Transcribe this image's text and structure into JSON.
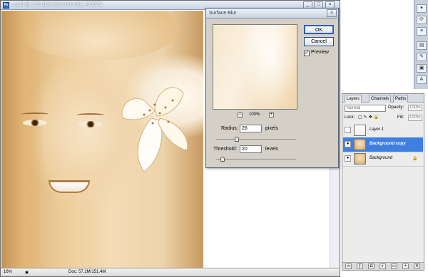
{
  "document": {
    "title": "1.psd @ 16% (Background copy, RGB/8)",
    "ps_icon": "Ps",
    "status_zoom": "16%",
    "status_doc": "Doc: 57.2M/151.4M"
  },
  "dialog": {
    "title": "Surface Blur",
    "ok_label": "OK",
    "cancel_label": "Cancel",
    "preview_label": "Preview",
    "preview_checked": true,
    "zoom_level": "100%",
    "radius_label": "Radius:",
    "radius_value": "26",
    "radius_unit": "pixels",
    "threshold_label": "Threshold:",
    "threshold_value": "20",
    "threshold_unit": "levels",
    "radius_slider_fraction": 0.26,
    "threshold_slider_fraction": 0.08
  },
  "layers_panel": {
    "tabs": [
      {
        "label": "Layers",
        "active": true
      },
      {
        "label": "Channels",
        "active": false
      },
      {
        "label": "Paths",
        "active": false
      }
    ],
    "blend_mode": "Normal",
    "opacity_label": "Opacity:",
    "opacity_value": "100%",
    "lock_label": "Lock:",
    "fill_label": "Fill:",
    "fill_value": "100%",
    "layers": [
      {
        "name": "Layer 1",
        "visible": false,
        "selected": false,
        "thumb": "white-blur"
      },
      {
        "name": "Background copy",
        "visible": true,
        "selected": true,
        "thumb": "portrait"
      },
      {
        "name": "Background",
        "visible": true,
        "selected": false,
        "thumb": "portrait",
        "locked": true
      }
    ]
  },
  "icons": {
    "close": "×",
    "eye": "visibility-eye-icon",
    "lock": "lock-icon"
  },
  "colors": {
    "selection": "#3e7fe0",
    "photo_tone": "#eccc98",
    "dialog_bg": "#d4d0c8"
  }
}
